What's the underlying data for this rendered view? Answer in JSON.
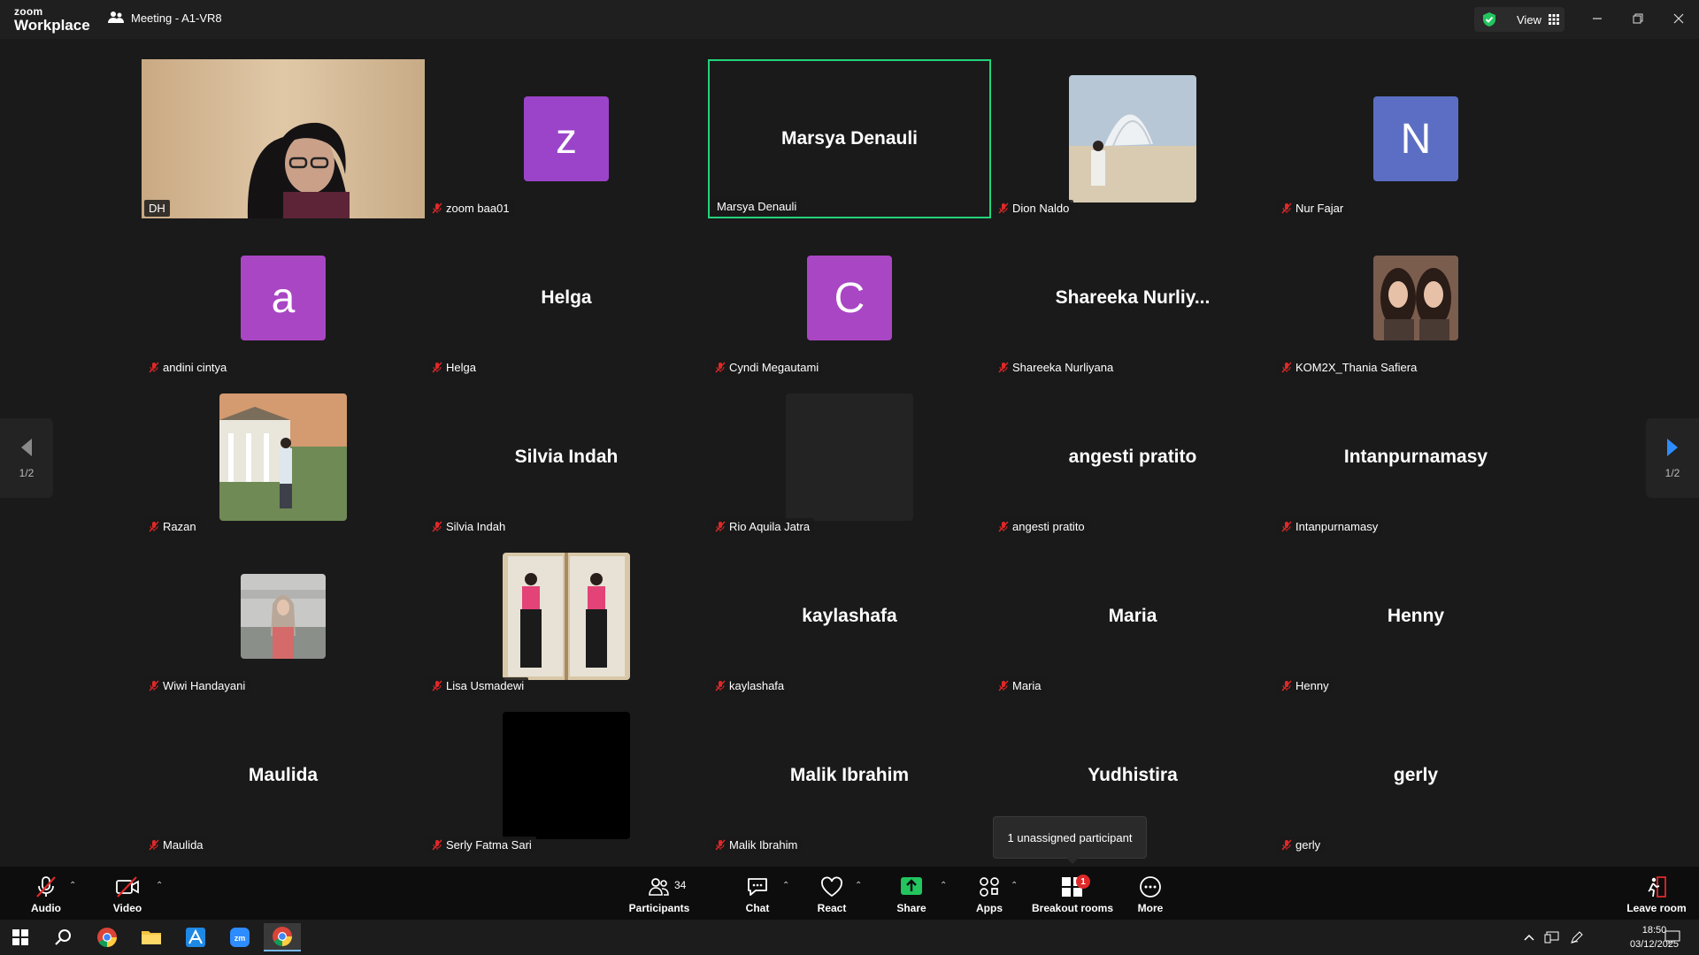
{
  "app": {
    "logo_line1": "zoom",
    "logo_line2": "Workplace",
    "meeting_title": "Meeting - A1-VR8",
    "view_label": "View"
  },
  "colors": {
    "active_speaker_border": "#22d47b",
    "avatar_purple": "#9b44c9",
    "avatar_indigo": "#5b6ec4",
    "share_green": "#22c55e",
    "badge_red": "#e02828"
  },
  "participants": [
    {
      "id": "dh",
      "name": "DH",
      "mode": "video",
      "muted": false
    },
    {
      "id": "zoom-baa01",
      "name": "zoom baa01",
      "mode": "avatar",
      "letter": "z",
      "color": "#9b44c9",
      "muted": true
    },
    {
      "id": "marsya",
      "name": "Marsya Denauli",
      "mode": "name",
      "display": "Marsya Denauli",
      "active": true,
      "muted": false
    },
    {
      "id": "dion",
      "name": "Dion Naldo",
      "mode": "photo",
      "photo": "beach",
      "muted": true
    },
    {
      "id": "nur-fajar",
      "name": "Nur Fajar",
      "mode": "avatar",
      "letter": "N",
      "color": "#5b6ec4",
      "muted": true
    },
    {
      "id": "andini",
      "name": "andini cintya",
      "mode": "avatar",
      "letter": "a",
      "color": "#a946c4",
      "muted": true
    },
    {
      "id": "helga",
      "name": "Helga",
      "mode": "name",
      "display": "Helga",
      "muted": true
    },
    {
      "id": "cyndi",
      "name": "Cyndi Megautami",
      "mode": "avatar",
      "letter": "C",
      "color": "#a946c4",
      "muted": true
    },
    {
      "id": "shareeka",
      "name": "Shareeka Nurliyana",
      "mode": "name",
      "display": "Shareeka  Nurliy...",
      "muted": true
    },
    {
      "id": "thania",
      "name": "KOM2X_Thania Safiera",
      "mode": "photo-small",
      "photo": "duo",
      "muted": true
    },
    {
      "id": "razan",
      "name": "Razan",
      "mode": "photo",
      "photo": "house",
      "muted": true
    },
    {
      "id": "silvia",
      "name": "Silvia Indah",
      "mode": "name",
      "display": "Silvia Indah",
      "muted": true
    },
    {
      "id": "rio",
      "name": "Rio Aquila Jatra",
      "mode": "blank",
      "muted": true
    },
    {
      "id": "angesti",
      "name": "angesti pratito",
      "mode": "name",
      "display": "angesti pratito",
      "muted": true
    },
    {
      "id": "intan",
      "name": "Intanpurnamasy",
      "mode": "name",
      "display": "Intanpurnamasy",
      "muted": true
    },
    {
      "id": "wiwi",
      "name": "Wiwi Handayani",
      "mode": "photo-small",
      "photo": "hijab",
      "muted": true
    },
    {
      "id": "lisa",
      "name": "Lisa Usmadewi",
      "mode": "photo",
      "photo": "mirror",
      "muted": true
    },
    {
      "id": "kaylashafa",
      "name": "kaylashafa",
      "mode": "name",
      "display": "kaylashafa",
      "muted": true
    },
    {
      "id": "maria",
      "name": "Maria",
      "mode": "name",
      "display": "Maria",
      "muted": true
    },
    {
      "id": "henny",
      "name": "Henny",
      "mode": "name",
      "display": "Henny",
      "muted": true
    },
    {
      "id": "maulida",
      "name": "Maulida",
      "mode": "name",
      "display": "Maulida",
      "muted": true
    },
    {
      "id": "serly",
      "name": "Serly Fatma Sari",
      "mode": "black",
      "muted": true
    },
    {
      "id": "malik",
      "name": "Malik Ibrahim",
      "mode": "name",
      "display": "Malik Ibrahim",
      "muted": true
    },
    {
      "id": "yudhistira",
      "name": "Yudhistira",
      "mode": "name",
      "display": "Yudhistira",
      "nametag": false,
      "muted": true
    },
    {
      "id": "gerly",
      "name": "gerly",
      "mode": "name",
      "display": "gerly",
      "muted": true
    }
  ],
  "pagination": {
    "left": "1/2",
    "right": "1/2"
  },
  "tooltip": {
    "text": "1 unassigned participant"
  },
  "toolbar": {
    "audio": "Audio",
    "video": "Video",
    "participants": "Participants",
    "participants_count": "34",
    "chat": "Chat",
    "react": "React",
    "share": "Share",
    "apps": "Apps",
    "breakout": "Breakout rooms",
    "breakout_badge": "1",
    "more": "More",
    "leave": "Leave room"
  },
  "taskbar": {
    "time": "18:50",
    "date": "03/12/2025"
  }
}
